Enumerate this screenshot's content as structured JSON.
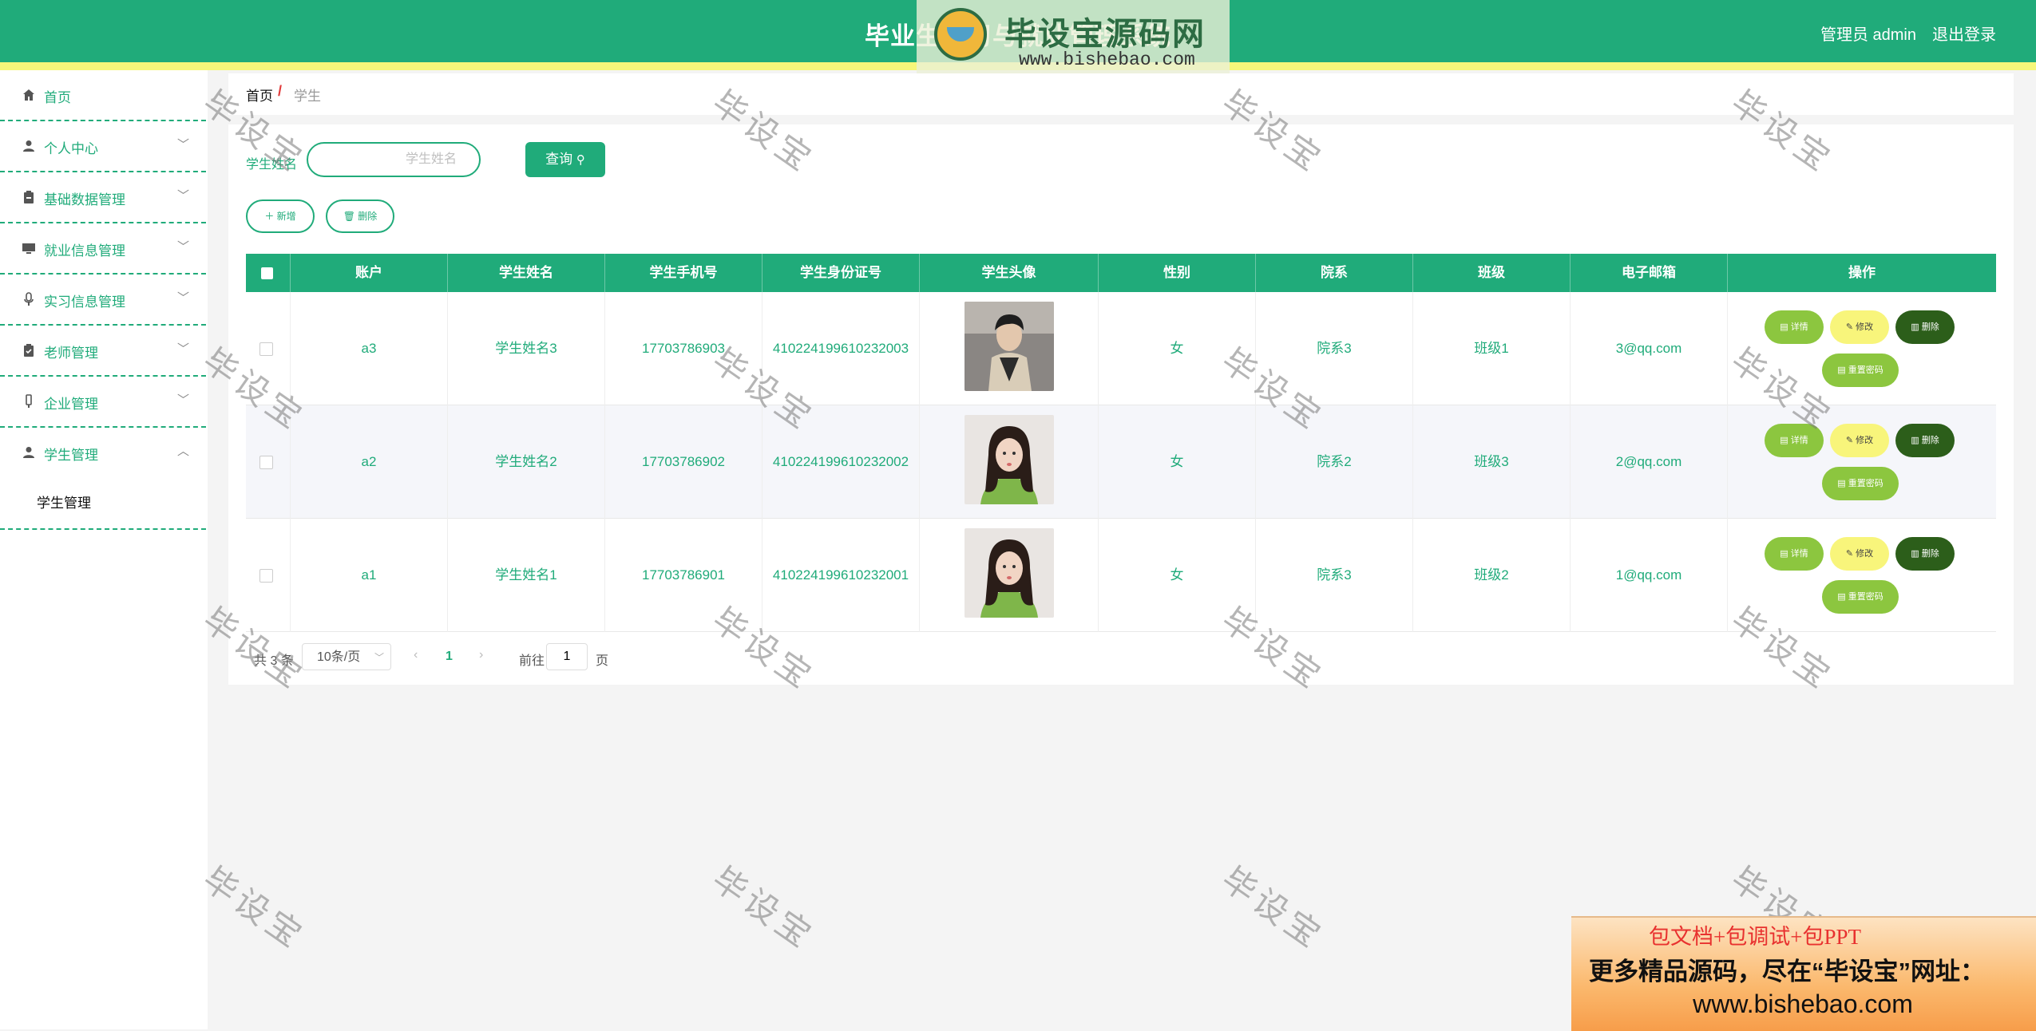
{
  "header": {
    "title": "毕业生实习与就业管理系统",
    "user": "管理员 admin",
    "logout": "退出登录",
    "logo_text": "毕设宝源码网",
    "logo_url": "www.bishebao.com",
    "bg_color": "#20ab7a",
    "stripe_color": "#f6f77a"
  },
  "sidebar": {
    "items": [
      {
        "label": "首页",
        "icon": "home-icon",
        "expanded": null
      },
      {
        "label": "个人中心",
        "icon": "user-icon",
        "expanded": false
      },
      {
        "label": "基础数据管理",
        "icon": "clipboard-icon",
        "expanded": false
      },
      {
        "label": "就业信息管理",
        "icon": "monitor-icon",
        "expanded": false
      },
      {
        "label": "实习信息管理",
        "icon": "microphone-icon",
        "expanded": false
      },
      {
        "label": "老师管理",
        "icon": "clipboard-check-icon",
        "expanded": false
      },
      {
        "label": "企业管理",
        "icon": "device-icon",
        "expanded": false
      },
      {
        "label": "学生管理",
        "icon": "user-icon",
        "expanded": true
      }
    ],
    "subitems": [
      {
        "label": "学生管理"
      }
    ]
  },
  "breadcrumb": {
    "home": "首页",
    "separator": "/",
    "current": "学生"
  },
  "search": {
    "label": "学生姓名",
    "placeholder": "学生姓名",
    "value": "",
    "button": "查询"
  },
  "actions": {
    "add": "新增",
    "delete": "删除"
  },
  "table": {
    "columns": [
      "账户",
      "学生姓名",
      "学生手机号",
      "学生身份证号",
      "学生头像",
      "性别",
      "院系",
      "班级",
      "电子邮箱",
      "操作"
    ],
    "rows": [
      {
        "account": "a3",
        "name": "学生姓名3",
        "phone": "17703786903",
        "id_card": "410224199610232003",
        "avatar": "avatar-male",
        "gender": "女",
        "department": "院系3",
        "class": "班级1",
        "email": "3@qq.com"
      },
      {
        "account": "a2",
        "name": "学生姓名2",
        "phone": "17703786902",
        "id_card": "410224199610232002",
        "avatar": "avatar-female",
        "gender": "女",
        "department": "院系2",
        "class": "班级3",
        "email": "2@qq.com"
      },
      {
        "account": "a1",
        "name": "学生姓名1",
        "phone": "17703786901",
        "id_card": "410224199610232001",
        "avatar": "avatar-female",
        "gender": "女",
        "department": "院系3",
        "class": "班级2",
        "email": "1@qq.com"
      }
    ],
    "row_buttons": {
      "detail": "详情",
      "edit": "修改",
      "delete": "删除",
      "reset": "重置密码"
    }
  },
  "pagination": {
    "total": "共 3 条",
    "page_size": "10条/页",
    "current_page": "1",
    "goto_label": "前往",
    "goto_value": "1",
    "page_unit": "页"
  },
  "watermark": "毕设宝",
  "ad": {
    "line1": "包文档+包调试+包PPT",
    "line2": "更多精品源码，尽在“毕设宝”网址：",
    "line3": "www.bishebao.com"
  }
}
